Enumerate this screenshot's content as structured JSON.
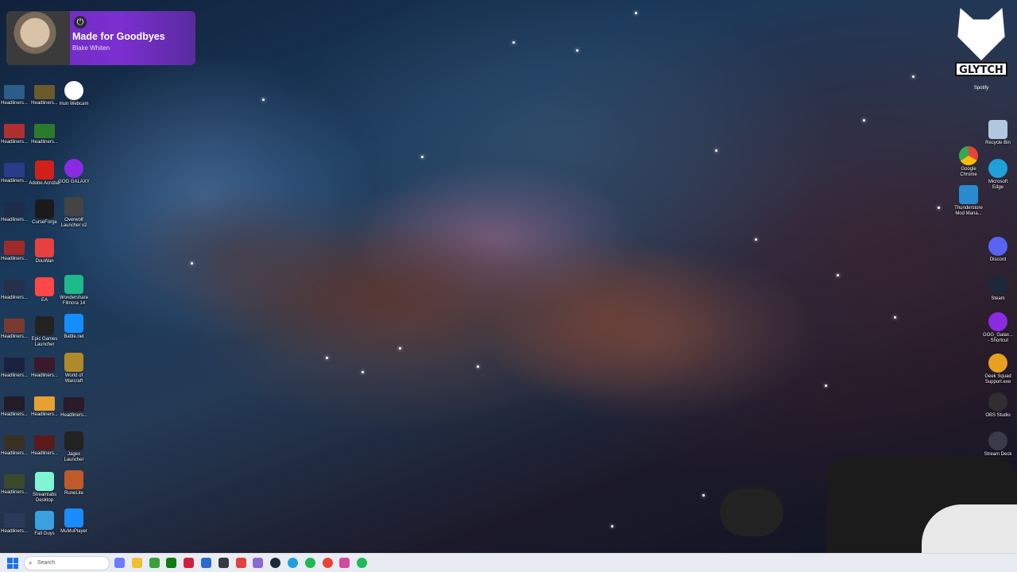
{
  "now_playing": {
    "title": "Made for Goodbyes",
    "artist": "Blake Whiten"
  },
  "left_column_1": [
    {
      "label": "Headliners...",
      "color": "#2c5d8a"
    },
    {
      "label": "Headliners...",
      "color": "#b03030"
    },
    {
      "label": "Headliners...",
      "color": "#2a3b8c"
    },
    {
      "label": "Headliners...",
      "color": "#1c2c4a"
    },
    {
      "label": "Headliners...",
      "color": "#a02a2a"
    },
    {
      "label": "Headliners...",
      "color": "#25304a"
    },
    {
      "label": "Headliners...",
      "color": "#7a3a30"
    },
    {
      "label": "Headliners...",
      "color": "#1a2240"
    },
    {
      "label": "Headliners...",
      "color": "#241a28"
    },
    {
      "label": "Headliners...",
      "color": "#3a3020"
    },
    {
      "label": "Headliners...",
      "color": "#3a4a2a"
    },
    {
      "label": "Headliners...",
      "color": "#2a3a5a"
    }
  ],
  "left_column_2": [
    {
      "label": "Headliners...",
      "color": "#6b5a2a"
    },
    {
      "label": "Headliners...",
      "color": "#2c7a2c"
    },
    {
      "label": "Adobe Acrobat",
      "color": "#d0201a"
    },
    {
      "label": "CurseForge",
      "color": "#1a1a1a"
    },
    {
      "label": "DouWan",
      "color": "#e84040"
    },
    {
      "label": "EA",
      "color": "#ff4747"
    },
    {
      "label": "Epic Games Launcher",
      "color": "#222222"
    },
    {
      "label": "Headliners...",
      "color": "#3a1a2a"
    },
    {
      "label": "Headliners...",
      "color": "#e8a030"
    },
    {
      "label": "Headliners...",
      "color": "#5a1a1a"
    },
    {
      "label": "Streamlabs Desktop",
      "color": "#80f5d2"
    },
    {
      "label": "Fall Guys",
      "color": "#3aa0e0"
    }
  ],
  "left_column_3": [
    {
      "label": "Iriun Webcam",
      "color": "#ffffff"
    },
    {
      "label": "GOG GALAXY",
      "color": "#8a2be2"
    },
    {
      "label": "Overwolf Launcher v2",
      "color": "#444444"
    },
    {
      "label": "Wondershare Filmora 14",
      "color": "#1db98a"
    },
    {
      "label": "Battle.net",
      "color": "#148eff"
    },
    {
      "label": "World of Warcraft",
      "color": "#b08a2a"
    },
    {
      "label": "Headliners...",
      "color": "#2a1a2a"
    },
    {
      "label": "Jagex Launcher",
      "color": "#222222"
    },
    {
      "label": "RuneLite",
      "color": "#c05a2a"
    },
    {
      "label": "MuMuPlayer",
      "color": "#1a8cff"
    }
  ],
  "glytch": {
    "logo_text": "GLYTCH",
    "caption": "Spotify"
  },
  "right_column_1": [
    {
      "label": "Google Chrome",
      "color": "#34a853"
    },
    {
      "label": "Thunderstore Mod Mana...",
      "color": "#2a8ad0"
    }
  ],
  "right_column_2": [
    {
      "label": "Recycle Bin",
      "color": "#b0c8e0"
    },
    {
      "label": "Microsoft Edge",
      "color": "#1fa0d8"
    },
    {
      "label": "Discord",
      "color": "#5865f2"
    },
    {
      "label": "Steam",
      "color": "#1b2838"
    },
    {
      "label": "GOG_Galax... - Shortcut",
      "color": "#8a2be2"
    },
    {
      "label": "Geek Squad Support.exe",
      "color": "#e8a020"
    },
    {
      "label": "OBS Studio",
      "color": "#302e31"
    },
    {
      "label": "Stream Deck",
      "color": "#3a3a4a"
    }
  ],
  "taskbar": {
    "search_placeholder": "Search",
    "icons": [
      {
        "name": "copilot-icon",
        "color": "#6a7cff"
      },
      {
        "name": "file-explorer-icon",
        "color": "#f0c030"
      },
      {
        "name": "minecraft-icon",
        "color": "#3aa03a"
      },
      {
        "name": "xbox-icon",
        "color": "#107c10"
      },
      {
        "name": "app-icon-red",
        "color": "#d02040"
      },
      {
        "name": "app-icon-blue",
        "color": "#2a6ad0"
      },
      {
        "name": "app-icon-dark",
        "color": "#333a44"
      },
      {
        "name": "app-icon-mixed",
        "color": "#e04040"
      },
      {
        "name": "app-icon-purple",
        "color": "#8a6ad0"
      },
      {
        "name": "steam-icon",
        "color": "#1b2838"
      },
      {
        "name": "edge-icon",
        "color": "#1fa0d8"
      },
      {
        "name": "spotify-icon",
        "color": "#1db954"
      },
      {
        "name": "chrome-icon",
        "color": "#ea4335"
      },
      {
        "name": "app-icon-pink",
        "color": "#d04aa0"
      },
      {
        "name": "spotify-icon-2",
        "color": "#1db954"
      }
    ]
  }
}
